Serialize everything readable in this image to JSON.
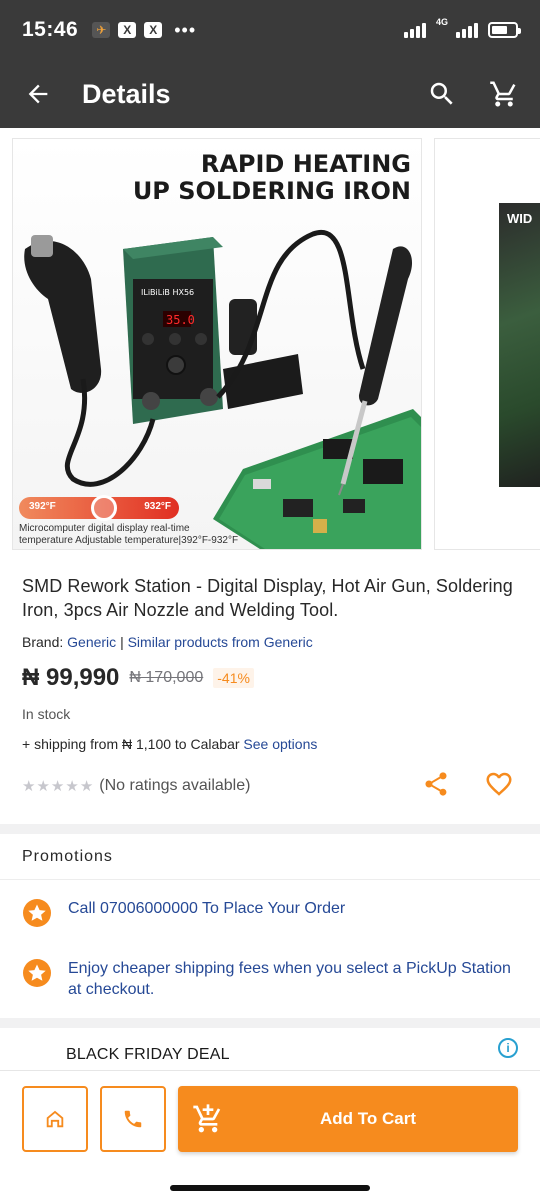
{
  "status_bar": {
    "time": "15:46",
    "notifications": [
      "app-icon",
      "x-icon",
      "x-icon"
    ],
    "more": "•••",
    "network": "4G"
  },
  "app_bar": {
    "title": "Details",
    "icons": [
      "back-arrow-icon",
      "search-icon",
      "cart-icon"
    ]
  },
  "gallery": {
    "headline_line1": "RAPID HEATING",
    "headline_line2": "UP SOLDERING IRON",
    "temp_min": "392°F",
    "temp_max": "932°F",
    "caption_line1": "Microcomputer digital display real-time",
    "caption_line2": "temperature Adjustable temperature|392°F-932°F",
    "display_reading": "35.0",
    "next_image_text": "WID"
  },
  "product": {
    "title": "SMD Rework Station -  Digital Display, Hot Air Gun, Soldering Iron, 3pcs Air Nozzle and Welding Tool.",
    "brand_label": "Brand:",
    "brand_name": "Generic",
    "brand_separator": "|",
    "similar_link": "Similar products from Generic",
    "price": "₦ 99,990",
    "old_price": "₦ 170,000",
    "discount": "-41%",
    "stock": "In stock",
    "shipping_text": "+ shipping from ₦ 1,100 to Calabar",
    "shipping_link": "See options",
    "rating_text": "(No ratings available)",
    "rating_value": 0,
    "rating_max": 5
  },
  "promotions": {
    "header": "Promotions",
    "items": [
      "Call 07006000000 To Place Your Order",
      "Enjoy cheaper shipping fees when you select a PickUp Station at checkout."
    ]
  },
  "ad": {
    "text": "BLACK FRIDAY DEAL",
    "info_icon": "i"
  },
  "bottom_bar": {
    "add_to_cart": "Add To Cart"
  },
  "colors": {
    "accent": "#f68b1e",
    "link": "#264996",
    "header_bg": "#3a3a3a"
  }
}
